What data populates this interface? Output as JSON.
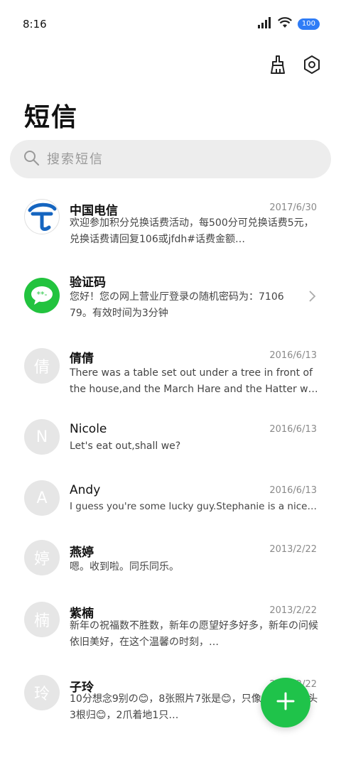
{
  "status_bar": {
    "time": "8:16",
    "battery": "100"
  },
  "header": {
    "title": "短信",
    "brush_icon": "brush-icon",
    "settings_icon": "settings-icon"
  },
  "search": {
    "placeholder": "搜索短信"
  },
  "colors": {
    "fab": "#1fc34a",
    "battery": "#2f7cf6",
    "verify_avatar": "#22c33e",
    "telecom_blue": "#1565c0"
  },
  "messages": [
    {
      "name": "中国电信",
      "date": "2017/6/30",
      "preview": "欢迎参加积分兑换话费活动，每500分可兑换话费5元，兑换话费请回复106或jfdh#话费金额…",
      "avatar": "telecom-logo"
    },
    {
      "name": "验证码",
      "date": "",
      "preview": "您好！您の网上营业厅登录の随机密码为：710679。有效时间为3分钟",
      "avatar": "message-bubble-icon"
    },
    {
      "name": "倩倩",
      "date": "2016/6/13",
      "preview": "There was a table set out under a tree in front of the house,and the March Hare and the Hatter were havi…",
      "avatar_text": "倩"
    },
    {
      "name": "Nicole",
      "date": "2016/6/13",
      "preview": "Let's eat out,shall we?",
      "avatar_text": "N"
    },
    {
      "name": "Andy",
      "date": "2016/6/13",
      "preview": "I guess you're some lucky guy.Stephanie is a nice girl.",
      "avatar_text": "A"
    },
    {
      "name": "燕婷",
      "date": "2013/2/22",
      "preview": "嗯。收到啦。同乐同乐。",
      "avatar_text": "婷"
    },
    {
      "name": "紫楠",
      "date": "2013/2/22",
      "preview": "新年の祝福数不胜数，新年の愿望好多好多，新年の问候依旧美好，在这个温馨の时刻，…",
      "avatar_text": "楠"
    },
    {
      "name": "子玲",
      "date": "2013/2/22",
      "preview": "10分想念9别の😊，8张照片7张是😊，只像😊，4根骨头3根归😊，2爪着地1只…",
      "avatar_text": "玲"
    }
  ]
}
